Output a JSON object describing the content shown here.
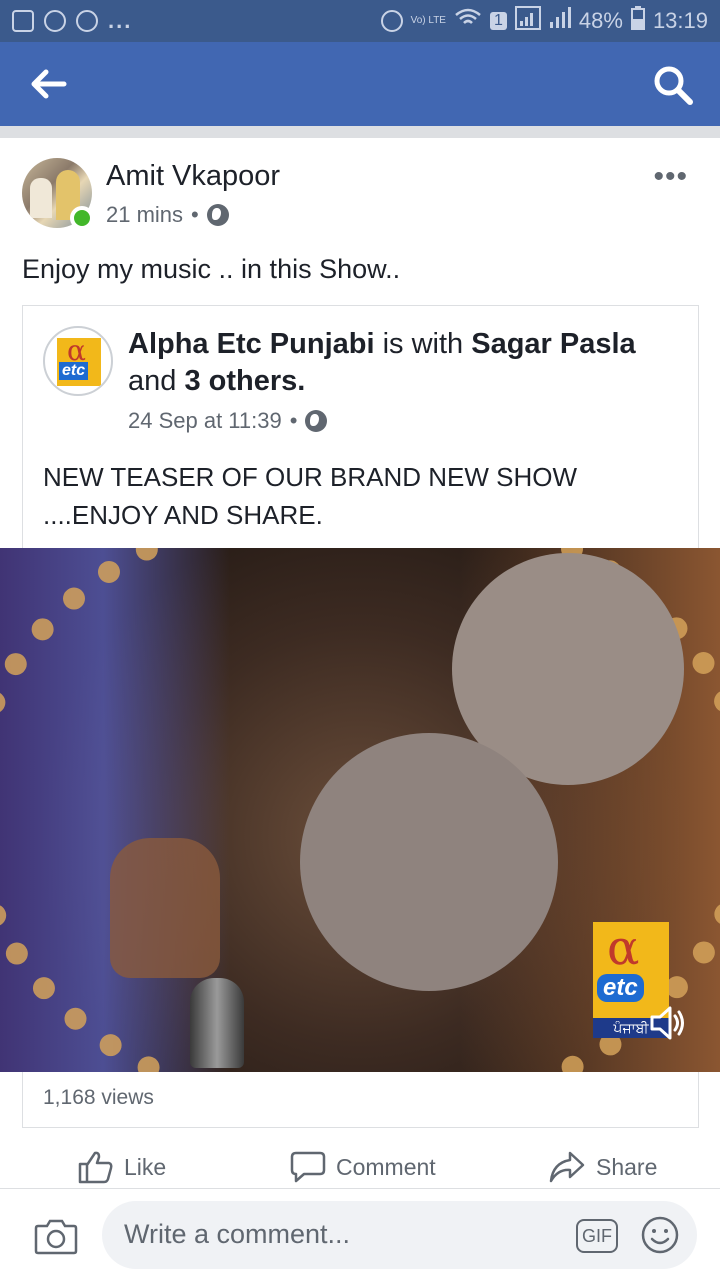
{
  "status_bar": {
    "battery": "48%",
    "time": "13:19",
    "more": "...",
    "volte": "Vo) LTE",
    "sim": "1"
  },
  "app_bar": {
    "back_icon": "arrow-left-icon",
    "search_icon": "search-icon",
    "colors": {
      "status": "#3b5a8c",
      "bar": "#4167b2"
    }
  },
  "post": {
    "author": "Amit Vkapoor",
    "time": "21 mins",
    "separator": "•",
    "caption": "Enjoy my music .. in this Show..",
    "more_label": "•••",
    "shared": {
      "page": "Alpha Etc Punjabi",
      "with_text": "is with",
      "tagged": "Sagar Pasla",
      "and_text": "and",
      "others": "3 others.",
      "time": "24 Sep at 11:39",
      "text": "NEW TEASER OF OUR BRAND NEW SHOW ....ENJOY AND SHARE."
    },
    "video": {
      "logo_alpha": "α",
      "logo_etc": "etc",
      "logo_punjabi": "ਪੰਜਾਬੀ"
    },
    "views": "1,168 views"
  },
  "actions": {
    "like": "Like",
    "comment": "Comment",
    "share": "Share"
  },
  "composer": {
    "placeholder": "Write a comment...",
    "gif": "GIF",
    "camera_icon": "camera-icon",
    "emoji_icon": "emoji-icon"
  }
}
